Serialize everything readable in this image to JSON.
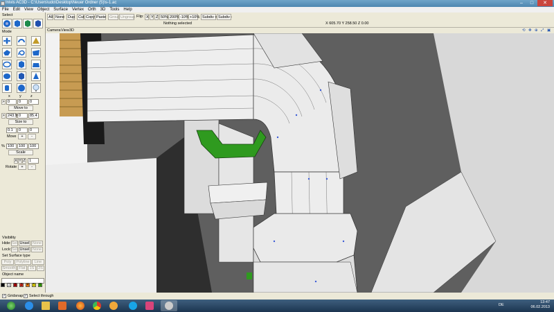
{
  "window": {
    "title": "Inivis AC3D - C:\\Users\\udo\\Desktop\\Neuer Ordner (5)\\s-1.ac"
  },
  "menu": [
    "File",
    "Edit",
    "View",
    "Object",
    "Surface",
    "Vertex",
    "Orth",
    "3D",
    "Tools",
    "Help"
  ],
  "toolbar": {
    "all": "All",
    "none": "None",
    "dup": "Dup",
    "cut": "Cut",
    "copy": "Copy",
    "paste": "Paste",
    "group": "Group",
    "ungroup": "Ungroup",
    "flip": "Flip:",
    "flip_x": "X",
    "flip_y": "Y",
    "flip_z": "Z",
    "zoom": [
      "50%",
      "200%",
      "-10%",
      "+10%"
    ],
    "subdiv_plus": "Subdiv +",
    "subdiv_minus": "Subdiv -",
    "status": "Nothing selected",
    "coords": "X 605.70 Y 258.50 Z 0.00"
  },
  "left": {
    "select_label": "Select",
    "mode_label": "Mode",
    "axis_headers": [
      "x",
      "y",
      "z"
    ],
    "move_values": [
      "0",
      "0",
      "0"
    ],
    "move_to": "Move to",
    "size_values": [
      "243.9",
      "0",
      "85.4"
    ],
    "size_to": "Size to",
    "move_step": [
      "0.1",
      "0",
      "0"
    ],
    "move_label": "Move",
    "scale_pct": "%",
    "scale_values": [
      "100",
      "100",
      "100"
    ],
    "scale_label": "Scale",
    "rotate_axes": [
      "X",
      "Y",
      "Z"
    ],
    "rotate_value": "1",
    "rotate_label": "Rotate",
    "plus": "+",
    "minus": "-",
    "expand": ">",
    "visibility_label": "Visibility",
    "hide_label": "Hide:",
    "lock_label": "Lock:",
    "sel": "Sel",
    "unsel": "Unsel",
    "none": "None",
    "surface_label": "Set Surface type",
    "surface_row1": [
      "Poly",
      "Polyline",
      "Line"
    ],
    "surface_row2": [
      "Smooth",
      "Flat",
      "1S",
      "2S"
    ],
    "object_name_label": "Object name",
    "palette": [
      {
        "label": "",
        "color": "#000000"
      },
      {
        "label": "1",
        "color": "#ffffff"
      },
      {
        "label": "2",
        "color": "#c00000"
      },
      {
        "label": "3",
        "color": "#e03020"
      },
      {
        "label": "4",
        "color": "#ff7f00"
      },
      {
        "label": "5",
        "color": "#ffee00"
      },
      {
        "label": "6",
        "color": "#40c000"
      }
    ]
  },
  "viewport": {
    "tabs": [
      "Camera",
      "View",
      "3D"
    ]
  },
  "bottom": {
    "gridsnap": "Gridsnap",
    "select_through": "Select through"
  },
  "taskbar": {
    "lang": "DE",
    "time": "13:47",
    "date": "06.02.2013"
  },
  "colors": {
    "viewport_bg": "#5f5f5f",
    "pipe": "#ececec",
    "green_part": "#2f9a1f",
    "edge": "#333333"
  }
}
